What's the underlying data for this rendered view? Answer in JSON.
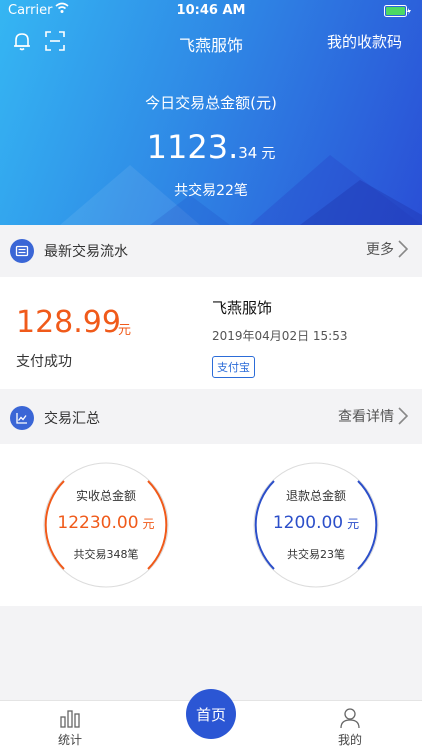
{
  "status_bar": {
    "carrier": "Carrier",
    "time": "10:46 AM"
  },
  "header": {
    "title": "飞燕服饰",
    "qr_link": "我的收款码",
    "today_label": "今日交易总金额(元)",
    "today_amount_int": "1123.",
    "today_amount_dec": "34",
    "today_amount_unit": "元",
    "today_count": "共交易22笔",
    "icons": [
      "bell-icon",
      "scan-icon"
    ]
  },
  "latest": {
    "section_label": "最新交易流水",
    "more_label": "更多",
    "amount": "128.99",
    "amount_unit": "元",
    "status": "支付成功",
    "merchant": "飞燕服饰",
    "datetime": "2019年04月02日 15:53",
    "method": "支付宝"
  },
  "summary": {
    "section_label": "交易汇总",
    "detail_label": "查看详情",
    "received": {
      "label": "实收总金额",
      "amount": "12230.00",
      "unit": "元",
      "count": "共交易348笔",
      "color": "#f05a1a"
    },
    "refund": {
      "label": "退款总金额",
      "amount": "1200.00",
      "unit": "元",
      "count": "共交易23笔",
      "color": "#2c4fc9"
    }
  },
  "tabbar": {
    "stats": "统计",
    "home": "首页",
    "mine": "我的"
  },
  "colors": {
    "accent": "#2b56d4",
    "orange": "#f05a1a"
  }
}
